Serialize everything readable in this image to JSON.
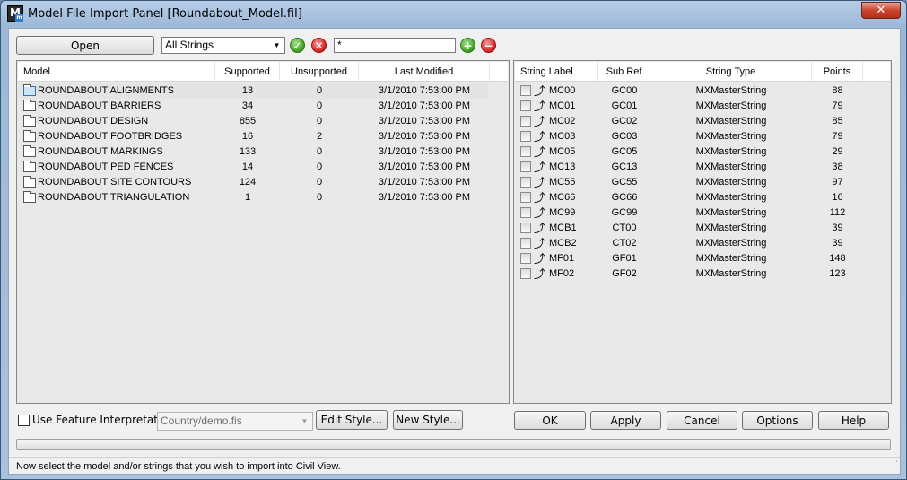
{
  "window": {
    "title": "Model File Import Panel [Roundabout_Model.fil]",
    "icon_letter": "M",
    "icon_sub": "m",
    "close_glyph": "✕"
  },
  "toolbar": {
    "open_label": "Open",
    "filter_combo": "All Strings",
    "accept_icon": "check-icon",
    "reject_icon": "x-icon",
    "pattern_value": "*",
    "add_icon": "plus-icon",
    "remove_icon": "minus-icon"
  },
  "models": {
    "columns": [
      "Model",
      "Supported",
      "Unsupported",
      "Last Modified"
    ],
    "rows": [
      {
        "name": "ROUNDABOUT ALIGNMENTS",
        "supported": "13",
        "unsupported": "0",
        "modified": "3/1/2010 7:53:00 PM",
        "selected": true
      },
      {
        "name": "ROUNDABOUT BARRIERS",
        "supported": "34",
        "unsupported": "0",
        "modified": "3/1/2010 7:53:00 PM"
      },
      {
        "name": "ROUNDABOUT DESIGN",
        "supported": "855",
        "unsupported": "0",
        "modified": "3/1/2010 7:53:00 PM"
      },
      {
        "name": "ROUNDABOUT FOOTBRIDGES",
        "supported": "16",
        "unsupported": "2",
        "modified": "3/1/2010 7:53:00 PM"
      },
      {
        "name": "ROUNDABOUT MARKINGS",
        "supported": "133",
        "unsupported": "0",
        "modified": "3/1/2010 7:53:00 PM"
      },
      {
        "name": "ROUNDABOUT PED FENCES",
        "supported": "14",
        "unsupported": "0",
        "modified": "3/1/2010 7:53:00 PM"
      },
      {
        "name": "ROUNDABOUT SITE CONTOURS",
        "supported": "124",
        "unsupported": "0",
        "modified": "3/1/2010 7:53:00 PM"
      },
      {
        "name": "ROUNDABOUT TRIANGULATION",
        "supported": "1",
        "unsupported": "0",
        "modified": "3/1/2010 7:53:00 PM"
      }
    ]
  },
  "strings": {
    "columns": [
      "String Label",
      "Sub Ref",
      "String Type",
      "Points"
    ],
    "rows": [
      {
        "label": "MC00",
        "subref": "GC00",
        "type": "MXMasterString",
        "points": "88"
      },
      {
        "label": "MC01",
        "subref": "GC01",
        "type": "MXMasterString",
        "points": "79"
      },
      {
        "label": "MC02",
        "subref": "GC02",
        "type": "MXMasterString",
        "points": "85"
      },
      {
        "label": "MC03",
        "subref": "GC03",
        "type": "MXMasterString",
        "points": "79"
      },
      {
        "label": "MC05",
        "subref": "GC05",
        "type": "MXMasterString",
        "points": "29"
      },
      {
        "label": "MC13",
        "subref": "GC13",
        "type": "MXMasterString",
        "points": "38"
      },
      {
        "label": "MC55",
        "subref": "GC55",
        "type": "MXMasterString",
        "points": "97"
      },
      {
        "label": "MC66",
        "subref": "GC66",
        "type": "MXMasterString",
        "points": "16"
      },
      {
        "label": "MC99",
        "subref": "GC99",
        "type": "MXMasterString",
        "points": "112"
      },
      {
        "label": "MCB1",
        "subref": "CT00",
        "type": "MXMasterString",
        "points": "39"
      },
      {
        "label": "MCB2",
        "subref": "CT02",
        "type": "MXMasterString",
        "points": "39"
      },
      {
        "label": "MF01",
        "subref": "GF01",
        "type": "MXMasterString",
        "points": "148"
      },
      {
        "label": "MF02",
        "subref": "GF02",
        "type": "MXMasterString",
        "points": "123"
      }
    ]
  },
  "bottom": {
    "use_feature_label": "Use Feature Interpretation",
    "style_combo": "Country/demo.fis",
    "edit_style_label": "Edit Style...",
    "new_style_label": "New Style...",
    "ok_label": "OK",
    "apply_label": "Apply",
    "cancel_label": "Cancel",
    "options_label": "Options",
    "help_label": "Help"
  },
  "status": {
    "text": "Now select the model and/or strings that you wish to import into Civil View."
  },
  "colors": {
    "title_gradient": "#9bb8d8",
    "selected_row": "#e0e0e0",
    "close_button": "#c9452e"
  }
}
